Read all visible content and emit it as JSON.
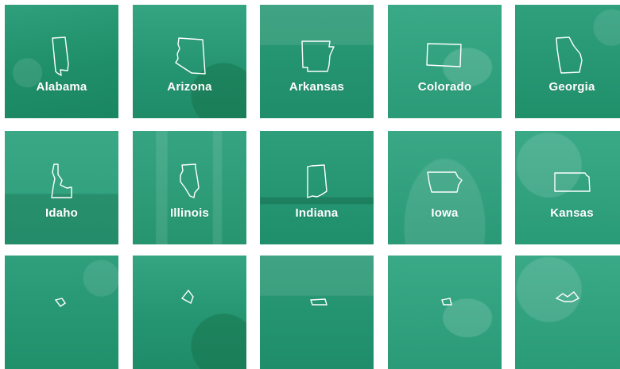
{
  "tiles": [
    {
      "label": "Alabama"
    },
    {
      "label": "Arizona"
    },
    {
      "label": "Arkansas"
    },
    {
      "label": "Colorado"
    },
    {
      "label": "Georgia"
    },
    {
      "label": "Idaho"
    },
    {
      "label": "Illinois"
    },
    {
      "label": "Indiana"
    },
    {
      "label": "Iowa"
    },
    {
      "label": "Kansas"
    }
  ]
}
